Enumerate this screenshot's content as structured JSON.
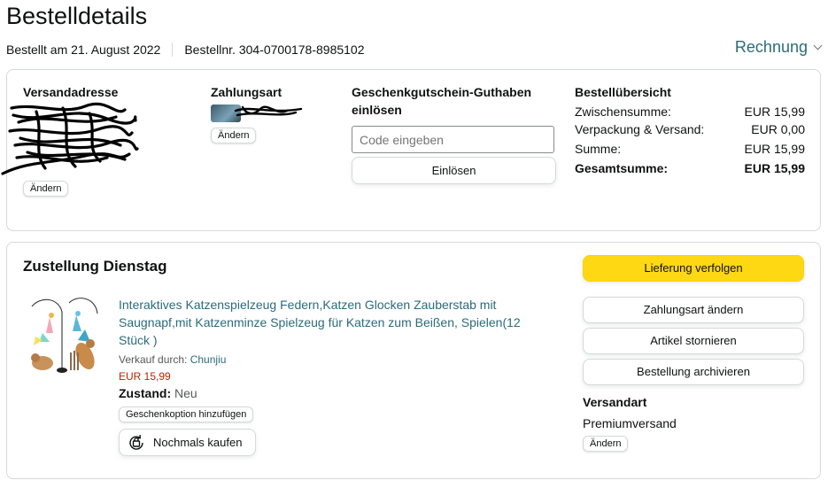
{
  "page": {
    "title": "Bestelldetails",
    "ordered_on": "Bestellt am 21. August 2022",
    "order_number": "Bestellnr. 304-0700178-8985102",
    "invoice_label": "Rechnung"
  },
  "overview": {
    "shipping_address": {
      "heading": "Versandadresse",
      "change_label": "Ändern"
    },
    "payment": {
      "heading": "Zahlungsart",
      "change_label": "Ändern"
    },
    "gift_card": {
      "heading_line1": "Geschenkgutschein-Guthaben",
      "heading_line2": "einlösen",
      "input_placeholder": "Code eingeben",
      "redeem_label": "Einlösen"
    },
    "summary": {
      "heading": "Bestellübersicht",
      "rows": [
        {
          "label": "Zwischensumme:",
          "value": "EUR 15,99"
        },
        {
          "label": "Verpackung & Versand:",
          "value": "EUR 0,00"
        },
        {
          "label": "Summe:",
          "value": "EUR 15,99"
        },
        {
          "label": "Gesamtsumme:",
          "value": "EUR 15,99"
        }
      ]
    }
  },
  "shipment": {
    "heading": "Zustellung Dienstag",
    "product": {
      "title": "Interaktives Katzenspielzeug Federn,Katzen Glocken Zauberstab mit Saugnapf,mit Katzenminze Spielzeug für Katzen zum Beißen, Spielen(12 Stück )",
      "sold_by_label": "Verkauf durch: ",
      "seller": "Chunjiu",
      "price": "EUR 15,99",
      "condition_label": "Zustand:",
      "condition_value": "Neu",
      "gift_option_label": "Geschenkoption hinzufügen",
      "buy_again_label": "Nochmals kaufen"
    },
    "actions": {
      "track": "Lieferung verfolgen",
      "change_payment": "Zahlungsart ändern",
      "cancel": "Artikel stornieren",
      "archive": "Bestellung archivieren"
    },
    "shipping_method": {
      "heading": "Versandart",
      "value": "Premiumversand",
      "change_label": "Ändern"
    }
  },
  "colors": {
    "link": "#2a6b7c",
    "price": "#b12704",
    "primary_button": "#ffd814",
    "border": "#d5d9d9"
  }
}
